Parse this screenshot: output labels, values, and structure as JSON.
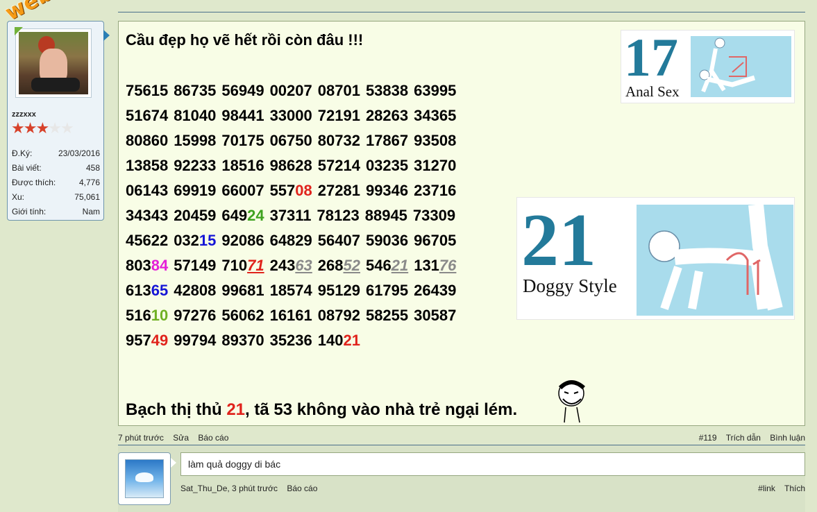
{
  "watermark": "webxoso.net",
  "user": {
    "username": "zzzxxx",
    "rating": {
      "filled": 3,
      "total": 5
    },
    "info": [
      {
        "label": "Đ.Ký:",
        "value": "23/03/2016"
      },
      {
        "label": "Bài viết:",
        "value": "458"
      },
      {
        "label": "Được thích:",
        "value": "4,776"
      },
      {
        "label": "Xu:",
        "value": "75,061"
      },
      {
        "label": "Giới tính:",
        "value": "Nam"
      }
    ]
  },
  "post": {
    "title": "Cầu đẹp họ vẽ hết rồi còn đâu !!!",
    "footer_before": "Bạch thị thủ",
    "footer_highlight": "21",
    "footer_after": ", tã 53 không vào nhà trẻ ngại lém.",
    "image1": {
      "number": "17",
      "caption": "Anal Sex"
    },
    "image2": {
      "number": "21",
      "caption": "Doggy Style"
    },
    "number_rows": [
      [
        [
          [
            "75615",
            ""
          ]
        ],
        [
          [
            "86735",
            ""
          ]
        ],
        [
          [
            "56949",
            ""
          ]
        ],
        [
          [
            "00207",
            ""
          ]
        ],
        [
          [
            "08701",
            ""
          ]
        ],
        [
          [
            "53838",
            ""
          ]
        ],
        [
          [
            "63995",
            ""
          ]
        ]
      ],
      [
        [
          [
            "51674",
            ""
          ]
        ],
        [
          [
            "81040",
            ""
          ]
        ],
        [
          [
            "98441",
            ""
          ]
        ],
        [
          [
            "33000",
            ""
          ]
        ],
        [
          [
            "72191",
            ""
          ]
        ],
        [
          [
            "28263",
            ""
          ]
        ],
        [
          [
            "34365",
            ""
          ]
        ]
      ],
      [
        [
          [
            "80860",
            ""
          ]
        ],
        [
          [
            "15998",
            ""
          ]
        ],
        [
          [
            "70175",
            ""
          ]
        ],
        [
          [
            "06750",
            ""
          ]
        ],
        [
          [
            "80732",
            ""
          ]
        ],
        [
          [
            "17867",
            ""
          ]
        ],
        [
          [
            "93508",
            ""
          ]
        ]
      ],
      [
        [
          [
            "13858",
            ""
          ]
        ],
        [
          [
            "92233",
            ""
          ]
        ],
        [
          [
            "18516",
            ""
          ]
        ],
        [
          [
            "98628",
            ""
          ]
        ],
        [
          [
            "57214",
            ""
          ]
        ],
        [
          [
            "03235",
            ""
          ]
        ],
        [
          [
            "31270",
            ""
          ]
        ]
      ],
      [
        [
          [
            "06143",
            ""
          ]
        ],
        [
          [
            "69919",
            ""
          ]
        ],
        [
          [
            "66007",
            ""
          ]
        ],
        [
          [
            "557",
            ""
          ],
          [
            "08",
            "c-red"
          ]
        ],
        [
          [
            "27281",
            ""
          ]
        ],
        [
          [
            "99346",
            ""
          ]
        ],
        [
          [
            "23716",
            ""
          ]
        ]
      ],
      [
        [
          [
            "34343",
            ""
          ]
        ],
        [
          [
            "20459",
            ""
          ]
        ],
        [
          [
            "649",
            ""
          ],
          [
            "24",
            "c-green"
          ]
        ],
        [
          [
            "37311",
            ""
          ]
        ],
        [
          [
            "78123",
            ""
          ]
        ],
        [
          [
            "88945",
            ""
          ]
        ],
        [
          [
            "73309",
            ""
          ]
        ]
      ],
      [
        [
          [
            "45622",
            ""
          ]
        ],
        [
          [
            "032",
            ""
          ],
          [
            "15",
            "c-blue"
          ]
        ],
        [
          [
            "92086",
            ""
          ]
        ],
        [
          [
            "64829",
            ""
          ]
        ],
        [
          [
            "56407",
            ""
          ]
        ],
        [
          [
            "59036",
            ""
          ]
        ],
        [
          [
            "96705",
            ""
          ]
        ]
      ],
      [
        [
          [
            "803",
            ""
          ],
          [
            "84",
            "c-magenta"
          ]
        ],
        [
          [
            "57149",
            ""
          ]
        ],
        [
          [
            "710",
            ""
          ],
          [
            "71",
            "c-redital"
          ]
        ],
        [
          [
            "243",
            ""
          ],
          [
            "63",
            "c-grayital"
          ]
        ],
        [
          [
            "268",
            ""
          ],
          [
            "52",
            "c-grayital"
          ]
        ],
        [
          [
            "546",
            ""
          ],
          [
            "21",
            "c-grayital"
          ]
        ],
        [
          [
            "131",
            ""
          ],
          [
            "76",
            "c-grayital"
          ]
        ]
      ],
      [
        [
          [
            "613",
            ""
          ],
          [
            "65",
            "c-blue"
          ]
        ],
        [
          [
            "42808",
            ""
          ]
        ],
        [
          [
            "99681",
            ""
          ]
        ],
        [
          [
            "18574",
            ""
          ]
        ],
        [
          [
            "95129",
            ""
          ]
        ],
        [
          [
            "61795",
            ""
          ]
        ],
        [
          [
            "26439",
            ""
          ]
        ]
      ],
      [
        [
          [
            "516",
            ""
          ],
          [
            "10",
            "c-lime"
          ]
        ],
        [
          [
            "97276",
            ""
          ]
        ],
        [
          [
            "56062",
            ""
          ]
        ],
        [
          [
            "16161",
            ""
          ]
        ],
        [
          [
            "08792",
            ""
          ]
        ],
        [
          [
            "58255",
            ""
          ]
        ],
        [
          [
            "30587",
            ""
          ]
        ]
      ],
      [
        [
          [
            "957",
            ""
          ],
          [
            "49",
            "c-red"
          ]
        ],
        [
          [
            "99794",
            ""
          ]
        ],
        [
          [
            "89370",
            ""
          ]
        ],
        [
          [
            "35236",
            ""
          ]
        ],
        [
          [
            "140",
            ""
          ],
          [
            "21",
            "c-red"
          ]
        ]
      ]
    ]
  },
  "post_meta": {
    "time": "7 phút trước",
    "edit": "Sửa",
    "report": "Báo cáo",
    "post_number": "#119",
    "quote": "Trích dẫn",
    "comment": "Bình luận"
  },
  "comment": {
    "text": "làm quả doggy di bác",
    "author": "Sat_Thu_De",
    "time": ", 3 phút trước",
    "report": "Báo cáo",
    "link": "#link",
    "like": "Thích"
  }
}
